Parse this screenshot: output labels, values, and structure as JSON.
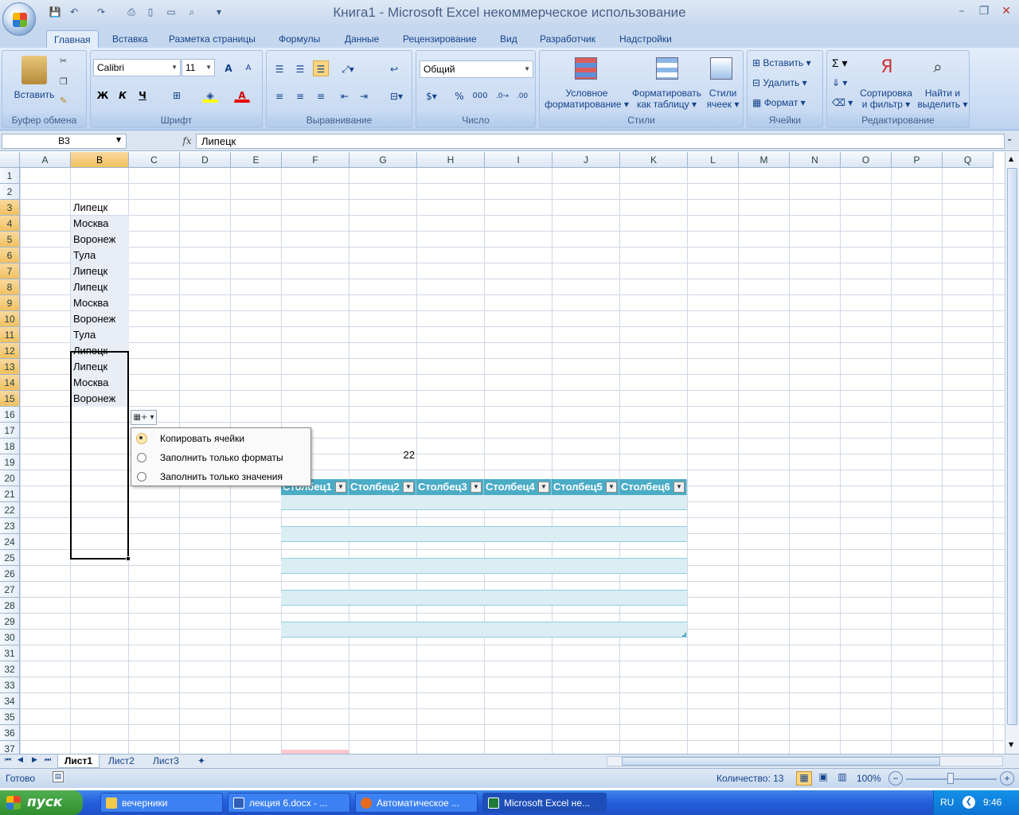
{
  "window": {
    "title": "Книга1 - Microsoft Excel некоммерческое использование"
  },
  "tabs": [
    "Главная",
    "Вставка",
    "Разметка страницы",
    "Формулы",
    "Данные",
    "Рецензирование",
    "Вид",
    "Разработчик",
    "Надстройки"
  ],
  "active_tab": "Главная",
  "ribbon": {
    "clipboard": {
      "label": "Буфер обмена",
      "paste": "Вставить"
    },
    "font": {
      "label": "Шрифт",
      "name": "Calibri",
      "size": "11",
      "bold": "Ж",
      "italic": "К",
      "underline": "Ч",
      "grow": "A",
      "shrink": "A"
    },
    "alignment": {
      "label": "Выравнивание"
    },
    "number": {
      "label": "Число",
      "format": "Общий",
      "percent": "%",
      "thousands": "000"
    },
    "styles": {
      "label": "Стили",
      "cond_l1": "Условное",
      "cond_l2": "форматирование",
      "table_l1": "Форматировать",
      "table_l2": "как таблицу",
      "cell_l1": "Стили",
      "cell_l2": "ячеек"
    },
    "cells": {
      "label": "Ячейки",
      "insert": "Вставить",
      "delete": "Удалить",
      "format": "Формат"
    },
    "editing": {
      "label": "Редактирование",
      "sort_l1": "Сортировка",
      "sort_l2": "и фильтр",
      "find_l1": "Найти и",
      "find_l2": "выделить",
      "sigma": "Σ"
    }
  },
  "formula_bar": {
    "name_box": "B3",
    "fx": "fx",
    "value": "Липецк"
  },
  "columns": [
    "A",
    "B",
    "C",
    "D",
    "E",
    "F",
    "G",
    "H",
    "I",
    "J",
    "K",
    "L",
    "M",
    "N",
    "O",
    "P",
    "Q"
  ],
  "selected_column": "B",
  "rows": [
    "1",
    "2",
    "3",
    "4",
    "5",
    "6",
    "7",
    "8",
    "9",
    "10",
    "11",
    "12",
    "13",
    "14",
    "15",
    "16",
    "17",
    "18",
    "19",
    "20",
    "21",
    "22",
    "23",
    "24",
    "25",
    "26",
    "27",
    "28",
    "29",
    "30",
    "31",
    "32",
    "33",
    "34",
    "35",
    "36",
    "37"
  ],
  "column_b_values": [
    "Липецк",
    "Москва",
    "Воронеж",
    "Тула",
    "Липецк",
    "Липецк",
    "Москва",
    "Воронеж",
    "Тула",
    "Липецк",
    "Липецк",
    "Москва",
    "Воронеж"
  ],
  "g9_value": "22",
  "table_headers": [
    "Столбец1",
    "Столбец2",
    "Столбец3",
    "Столбец4",
    "Столбец5",
    "Столбец6"
  ],
  "autofill_menu": {
    "items": [
      {
        "label": "Копировать ячейки",
        "selected": true
      },
      {
        "label": "Заполнить только форматы",
        "selected": false
      },
      {
        "label": "Заполнить только значения",
        "selected": false
      }
    ]
  },
  "sheets": [
    "Лист1",
    "Лист2",
    "Лист3"
  ],
  "active_sheet": "Лист1",
  "status": {
    "ready": "Готово",
    "count": "Количество: 13",
    "zoom": "100%"
  },
  "taskbar": {
    "start": "пуск",
    "tasks": [
      {
        "label": "вечерники",
        "color": "#f3c94b"
      },
      {
        "label": "лекция 6.docx - ...",
        "color": "#2f5fb8"
      },
      {
        "label": "Автоматическое ...",
        "color": "#e66b1f"
      },
      {
        "label": "Microsoft Excel не...",
        "color": "#1f7a3a"
      }
    ],
    "lang": "RU",
    "time": "9:46"
  },
  "colors": {
    "table_header": "#4bacc6",
    "table_band": "#daeef3",
    "highlight_cell": "#ffc7ce"
  }
}
